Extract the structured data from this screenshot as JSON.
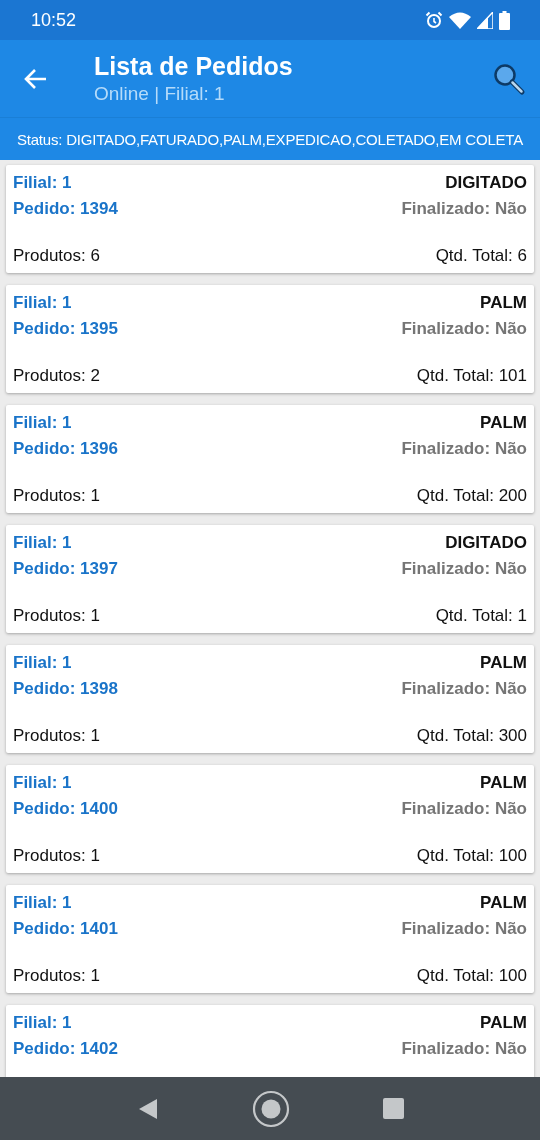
{
  "status_bar": {
    "time": "10:52"
  },
  "app_bar": {
    "title": "Lista de Pedidos",
    "subtitle": "Online | Filial: 1"
  },
  "filter": {
    "text": "Status: DIGITADO,FATURADO,PALM,EXPEDICAO,COLETADO,EM COLETA"
  },
  "orders": [
    {
      "filial": "Filial: 1",
      "pedido": "Pedido: 1394",
      "status": "DIGITADO",
      "finalizado": "Finalizado: Não",
      "produtos": "Produtos: 6",
      "qtd": "Qtd. Total: 6"
    },
    {
      "filial": "Filial: 1",
      "pedido": "Pedido: 1395",
      "status": "PALM",
      "finalizado": "Finalizado: Não",
      "produtos": "Produtos: 2",
      "qtd": "Qtd. Total: 101"
    },
    {
      "filial": "Filial: 1",
      "pedido": "Pedido: 1396",
      "status": "PALM",
      "finalizado": "Finalizado: Não",
      "produtos": "Produtos: 1",
      "qtd": "Qtd. Total: 200"
    },
    {
      "filial": "Filial: 1",
      "pedido": "Pedido: 1397",
      "status": "DIGITADO",
      "finalizado": "Finalizado: Não",
      "produtos": "Produtos: 1",
      "qtd": "Qtd. Total: 1"
    },
    {
      "filial": "Filial: 1",
      "pedido": "Pedido: 1398",
      "status": "PALM",
      "finalizado": "Finalizado: Não",
      "produtos": "Produtos: 1",
      "qtd": "Qtd. Total: 300"
    },
    {
      "filial": "Filial: 1",
      "pedido": "Pedido: 1400",
      "status": "PALM",
      "finalizado": "Finalizado: Não",
      "produtos": "Produtos: 1",
      "qtd": "Qtd. Total: 100"
    },
    {
      "filial": "Filial: 1",
      "pedido": "Pedido: 1401",
      "status": "PALM",
      "finalizado": "Finalizado: Não",
      "produtos": "Produtos: 1",
      "qtd": "Qtd. Total: 100"
    },
    {
      "filial": "Filial: 1",
      "pedido": "Pedido: 1402",
      "status": "PALM",
      "finalizado": "Finalizado: Não"
    }
  ]
}
